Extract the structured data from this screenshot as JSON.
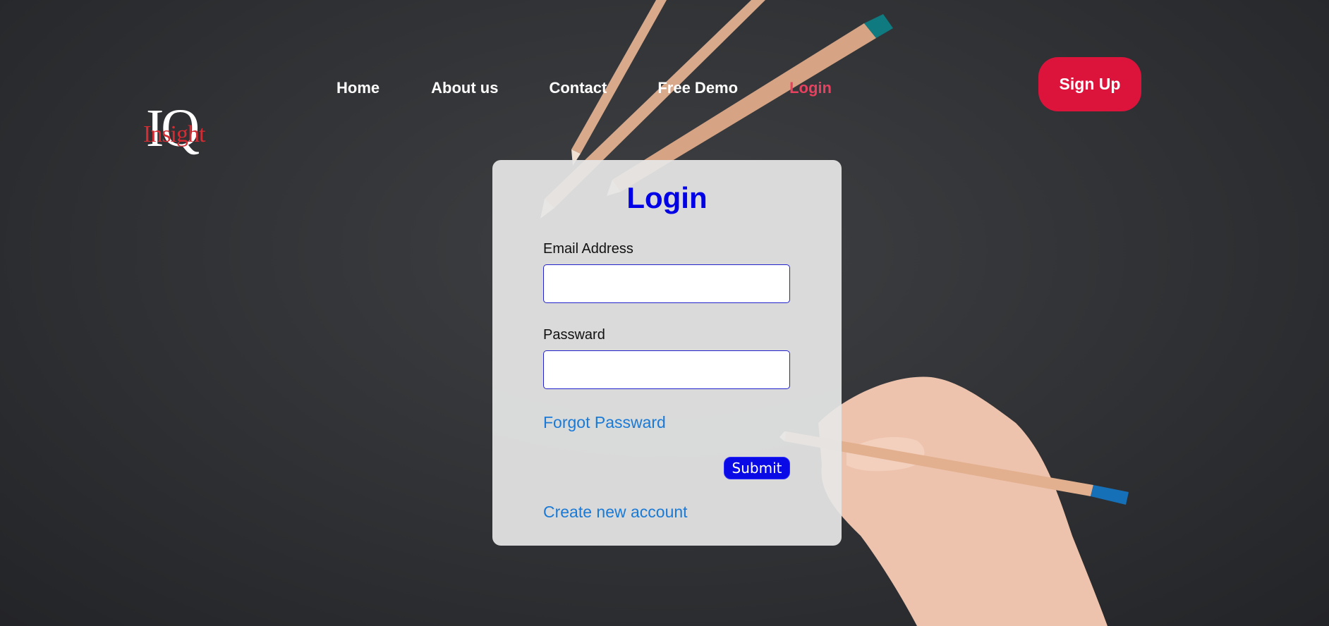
{
  "logo": {
    "mark": "IQ",
    "word": "Insight"
  },
  "nav": {
    "items": [
      {
        "label": "Home",
        "active": false
      },
      {
        "label": "About us",
        "active": false
      },
      {
        "label": "Contact",
        "active": false
      },
      {
        "label": "Free Demo",
        "active": false
      },
      {
        "label": "Login",
        "active": true
      }
    ],
    "signup_label": "Sign Up"
  },
  "login": {
    "title": "Login",
    "email_label": "Email Address",
    "email_value": "",
    "password_label": "Passward",
    "password_value": "",
    "forgot_label": "Forgot Passward",
    "submit_label": "Submit",
    "create_label": "Create new account"
  },
  "colors": {
    "accent_red": "#dc143c",
    "active_nav": "#e8405f",
    "title_blue": "#0000e6",
    "link_blue": "#1a7ad6",
    "logo_red": "#d52b33"
  }
}
